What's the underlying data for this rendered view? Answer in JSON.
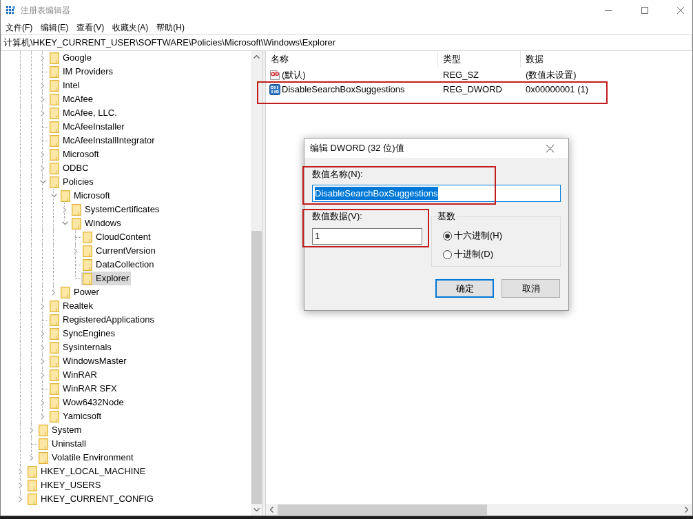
{
  "window": {
    "title": "注册表编辑器"
  },
  "menu": [
    "文件(F)",
    "编辑(E)",
    "查看(V)",
    "收藏夹(A)",
    "帮助(H)"
  ],
  "address_bar": {
    "path": "计算机\\HKEY_CURRENT_USER\\SOFTWARE\\Policies\\Microsoft\\Windows\\Explorer"
  },
  "tree": {
    "items": [
      {
        "children": [
          {
            "children": [
              {
                "label": "Google",
                "expandable": true,
                "expanded": false,
                "selected": false
              },
              {
                "label": "IM Providers",
                "expandable": false,
                "selected": false
              },
              {
                "label": "Intel",
                "expandable": true,
                "expanded": false,
                "selected": false
              },
              {
                "label": "McAfee",
                "expandable": true,
                "expanded": false,
                "selected": false
              },
              {
                "label": "McAfee, LLC.",
                "expandable": true,
                "expanded": false,
                "selected": false
              },
              {
                "label": "McAfeeInstaller",
                "expandable": false,
                "selected": false
              },
              {
                "label": "McAfeeInstallIntegrator",
                "expandable": false,
                "selected": false
              },
              {
                "label": "Microsoft",
                "expandable": true,
                "expanded": false,
                "selected": false
              },
              {
                "label": "ODBC",
                "expandable": true,
                "expanded": false,
                "selected": false
              },
              {
                "label": "Policies",
                "expandable": true,
                "expanded": true,
                "selected": false,
                "children": [
                  {
                    "label": "Microsoft",
                    "expandable": true,
                    "expanded": true,
                    "selected": false,
                    "children": [
                      {
                        "label": "SystemCertificates",
                        "expandable": true,
                        "expanded": false,
                        "selected": false
                      },
                      {
                        "label": "Windows",
                        "expandable": true,
                        "expanded": true,
                        "selected": false,
                        "children": [
                          {
                            "label": "CloudContent",
                            "expandable": false,
                            "selected": false
                          },
                          {
                            "label": "CurrentVersion",
                            "expandable": true,
                            "expanded": false,
                            "selected": false
                          },
                          {
                            "label": "DataCollection",
                            "expandable": false,
                            "selected": false
                          },
                          {
                            "label": "Explorer",
                            "expandable": false,
                            "selected": true
                          }
                        ]
                      }
                    ]
                  },
                  {
                    "label": "Power",
                    "expandable": true,
                    "expanded": false,
                    "selected": false
                  }
                ]
              },
              {
                "label": "Realtek",
                "expandable": true,
                "expanded": false,
                "selected": false
              },
              {
                "label": "RegisteredApplications",
                "expandable": false,
                "selected": false
              },
              {
                "label": "SyncEngines",
                "expandable": true,
                "expanded": false,
                "selected": false
              },
              {
                "label": "Sysinternals",
                "expandable": true,
                "expanded": false,
                "selected": false
              },
              {
                "label": "WindowsMaster",
                "expandable": true,
                "expanded": false,
                "selected": false
              },
              {
                "label": "WinRAR",
                "expandable": true,
                "expanded": false,
                "selected": false
              },
              {
                "label": "WinRAR SFX",
                "expandable": false,
                "selected": false
              },
              {
                "label": "Wow6432Node",
                "expandable": true,
                "expanded": false,
                "selected": false
              },
              {
                "label": "Yamicsoft",
                "expandable": true,
                "expanded": false,
                "selected": false
              }
            ]
          },
          {
            "label": "System",
            "expandable": true,
            "expanded": false,
            "selected": false
          },
          {
            "label": "Uninstall",
            "expandable": false,
            "selected": false
          },
          {
            "label": "Volatile Environment",
            "expandable": true,
            "expanded": false,
            "selected": false
          }
        ]
      },
      {
        "label": "HKEY_LOCAL_MACHINE",
        "expandable": true,
        "expanded": false,
        "selected": false
      },
      {
        "label": "HKEY_USERS",
        "expandable": true,
        "expanded": false,
        "selected": false
      },
      {
        "label": "HKEY_CURRENT_CONFIG",
        "expandable": true,
        "expanded": false,
        "selected": false
      }
    ]
  },
  "list": {
    "columns": [
      "名称",
      "类型",
      "数据"
    ],
    "rows": [
      {
        "kind": "string",
        "name": "(默认)",
        "type": "REG_SZ",
        "data": "(数值未设置)",
        "highlighted": false
      },
      {
        "kind": "dword",
        "name": "DisableSearchBoxSuggestions",
        "type": "REG_DWORD",
        "data": "0x00000001 (1)",
        "highlighted": true
      }
    ]
  },
  "dialog": {
    "title": "编辑 DWORD (32 位)值",
    "name_field": {
      "label": "数值名称(N):",
      "value": "DisableSearchBoxSuggestions",
      "focused": true,
      "highlighted": true
    },
    "data_field": {
      "label": "数值数据(V):",
      "value": "1",
      "focused": false,
      "highlighted": true
    },
    "base": {
      "title": "基数",
      "options": [
        {
          "label": "十六进制(H)",
          "selected": true
        },
        {
          "label": "十进制(D)",
          "selected": false
        }
      ]
    },
    "buttons": [
      {
        "label": "确定",
        "default": true
      },
      {
        "label": "取消",
        "default": false
      }
    ]
  }
}
